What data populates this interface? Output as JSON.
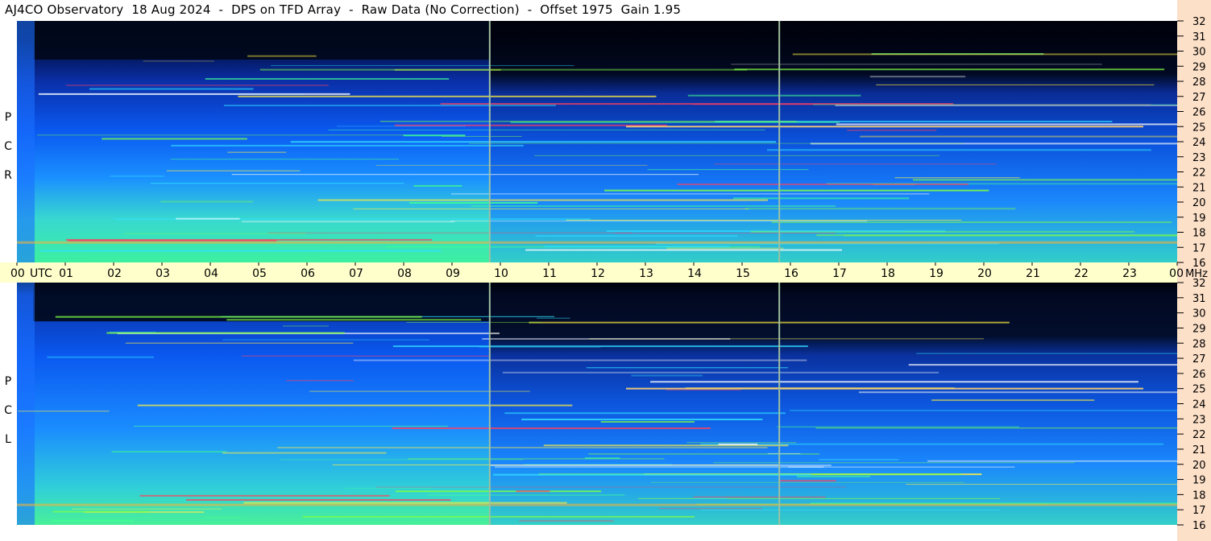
{
  "title": "AJ4CO Observatory  18 Aug 2024  -  DPS on TFD Array  -  Raw Data (No Correction)  -  Offset 1975  Gain 1.95",
  "chart_data": {
    "type": "heatmap",
    "title": "AJ4CO Observatory  18 Aug 2024  -  DPS on TFD Array  -  Raw Data (No Correction)  -  Offset 1975  Gain 1.95",
    "x_axis": {
      "label": "UTC",
      "ticks": [
        "00",
        "01",
        "02",
        "03",
        "04",
        "05",
        "06",
        "07",
        "08",
        "09",
        "10",
        "11",
        "12",
        "13",
        "14",
        "15",
        "16",
        "17",
        "18",
        "19",
        "20",
        "21",
        "22",
        "23",
        "00"
      ],
      "range_hours": [
        0,
        24
      ]
    },
    "y_axis": {
      "label": "MHz",
      "ticks": [
        "32",
        "31",
        "30",
        "29",
        "28",
        "27",
        "26",
        "25",
        "24",
        "23",
        "22",
        "21",
        "20",
        "19",
        "18",
        "17",
        "16"
      ],
      "range_mhz": [
        16,
        32
      ]
    },
    "panels": [
      {
        "name": "R C P",
        "letters": [
          "R",
          "C",
          "P"
        ]
      },
      {
        "name": "L C P",
        "letters": [
          "L",
          "C",
          "P"
        ]
      }
    ],
    "marker_hours": [
      9.78,
      15.77
    ],
    "colors": {
      "low": "#000010",
      "mid": "#0a5cff",
      "high": "#40ffb0",
      "peak": "#ff3050"
    }
  }
}
